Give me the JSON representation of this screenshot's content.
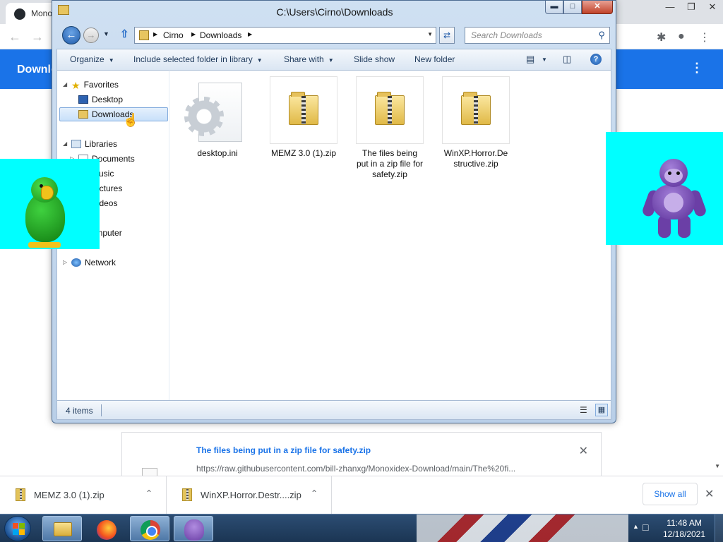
{
  "chrome": {
    "tab_title": "Mono",
    "header_title": "Downlo",
    "download_card": {
      "name": "The files being put in a zip file for safety.zip",
      "url": "https://raw.githubusercontent.com/bill-zhanxg/Monoxidex-Download/main/The%20fi..."
    },
    "shelf": {
      "items": [
        {
          "name": "MEMZ 3.0 (1).zip"
        },
        {
          "name": "WinXP.Horror.Destr....zip"
        }
      ],
      "show_all_label": "Show all"
    }
  },
  "explorer": {
    "title": "C:\\Users\\Cirno\\Downloads",
    "breadcrumb": [
      "Cirno",
      "Downloads"
    ],
    "search_placeholder": "Search Downloads",
    "toolbar": {
      "organize": "Organize",
      "include_in_library": "Include selected folder in library",
      "share_with": "Share with",
      "slide_show": "Slide show",
      "new_folder": "New folder"
    },
    "nav": {
      "favorites": "Favorites",
      "desktop": "Desktop",
      "downloads": "Downloads",
      "libraries": "Libraries",
      "documents": "Documents",
      "music": "Music",
      "pictures": "Pictures",
      "videos": "Videos",
      "computer": "Computer",
      "network": "Network"
    },
    "files": [
      {
        "name": "desktop.ini",
        "type": "settings-file"
      },
      {
        "name": "MEMZ 3.0 (1).zip",
        "type": "zip"
      },
      {
        "name": "The files being put in a zip file for safety.zip",
        "type": "zip"
      },
      {
        "name": "WinXP.Horror.Destructive.zip",
        "type": "zip"
      }
    ],
    "status": "4 items"
  },
  "taskbar": {
    "time": "11:48 AM",
    "date": "12/18/2021"
  },
  "icons": {
    "parrot": "parrot-agent-icon",
    "monkey": "bonzi-buddy-icon"
  }
}
